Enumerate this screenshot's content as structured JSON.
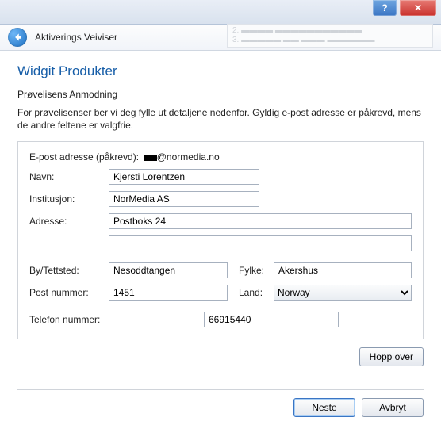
{
  "titlebar": {
    "help_label": "?",
    "close_label": "✕"
  },
  "wizard_header": {
    "title": "Aktiverings Veiviser",
    "ghost_lines": [
      "2. ▬▬▬▬ ▬▬▬▬▬▬▬▬▬▬▬",
      "3. ▬▬▬▬▬ ▬▬ ▬▬▬ ▬▬▬▬▬▬"
    ]
  },
  "page": {
    "title": "Widgit Produkter",
    "subheading": "Prøvelisens Anmodning",
    "instructions": "For prøvelisenser ber vi deg fylle ut detaljene nedenfor. Gyldig e-post adresse er påkrevd, mens de andre feltene er valgfrie."
  },
  "form": {
    "email_label": "E-post adresse (påkrevd):",
    "email_value_suffix": "@normedia.no",
    "name_label": "Navn:",
    "name_value": "Kjersti Lorentzen",
    "institution_label": "Institusjon:",
    "institution_value": "NorMedia AS",
    "address_label": "Adresse:",
    "address_value1": "Postboks 24",
    "address_value2": "",
    "city_label": "By/Tettsted:",
    "city_value": "Nesoddtangen",
    "county_label": "Fylke:",
    "county_value": "Akershus",
    "postcode_label": "Post nummer:",
    "postcode_value": "1451",
    "country_label": "Land:",
    "country_value": "Norway",
    "phone_label": "Telefon nummer:",
    "phone_value": "66915440"
  },
  "buttons": {
    "skip": "Hopp over",
    "next": "Neste",
    "cancel": "Avbryt"
  }
}
